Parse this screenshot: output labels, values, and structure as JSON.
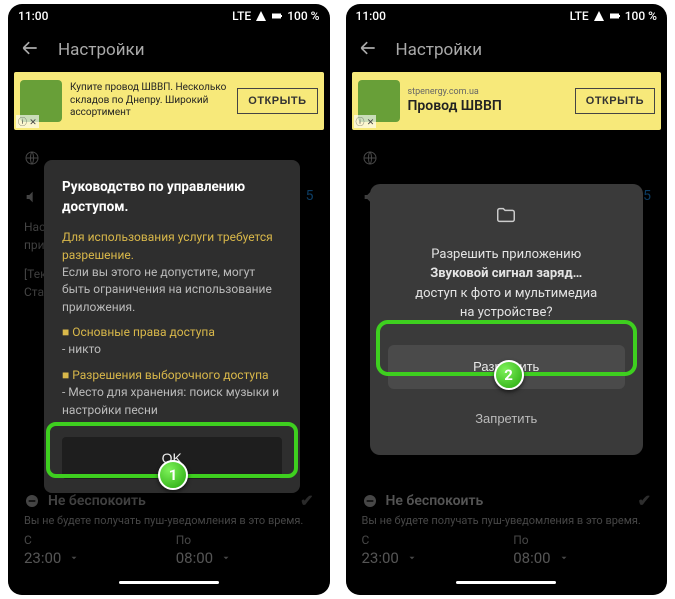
{
  "status": {
    "time": "11:00",
    "net": "LTE",
    "battery": "100 %"
  },
  "appbar": {
    "title": "Настройки"
  },
  "ad1": {
    "text": "Купите провод ШВВП. Несколько складов по Днепру. Широкий ассортимент",
    "button": "ОТКРЫТЬ",
    "badge": "ⓘ ✕"
  },
  "ad2": {
    "domain": "stpenergy.com.ua",
    "title": "Провод ШВВП",
    "button": "ОТКРЫТЬ",
    "badge": "ⓘ ✕"
  },
  "dialog1": {
    "title": "Руководство по управлению доступом.",
    "p1": "Для использования услуги требуется разрешение.",
    "p2": "Если вы этого не допустите, могут быть ограничения на использование приложения.",
    "b1": "■ Основные права доступа",
    "b1s": "- никто",
    "b2": "■ Разрешения выборочного доступа",
    "b2s": "- Место для хранения: поиск музыки и настройки песни",
    "ok": "OK"
  },
  "dialog2": {
    "line1": "Разрешить приложению",
    "line2": "Звуковой сигнал заряд…",
    "line3": "доступ к фото и мультимедиа",
    "line4": "на устройстве?",
    "allow": "Разрешить",
    "deny": "Запретить"
  },
  "bgrow": {
    "val5": "5"
  },
  "truncated": {
    "l1": "Наст",
    "l2": "при",
    "l3": "[Тек",
    "l4": "Ста"
  },
  "bottom": {
    "title": "Не беспокоить",
    "desc": "Вы не будете получать пуш-уведомления в это время.",
    "from_label": "С",
    "from_time": "23:00",
    "to_label": "По",
    "to_time": "08:00"
  },
  "badges": {
    "n1": "1",
    "n2": "2"
  }
}
